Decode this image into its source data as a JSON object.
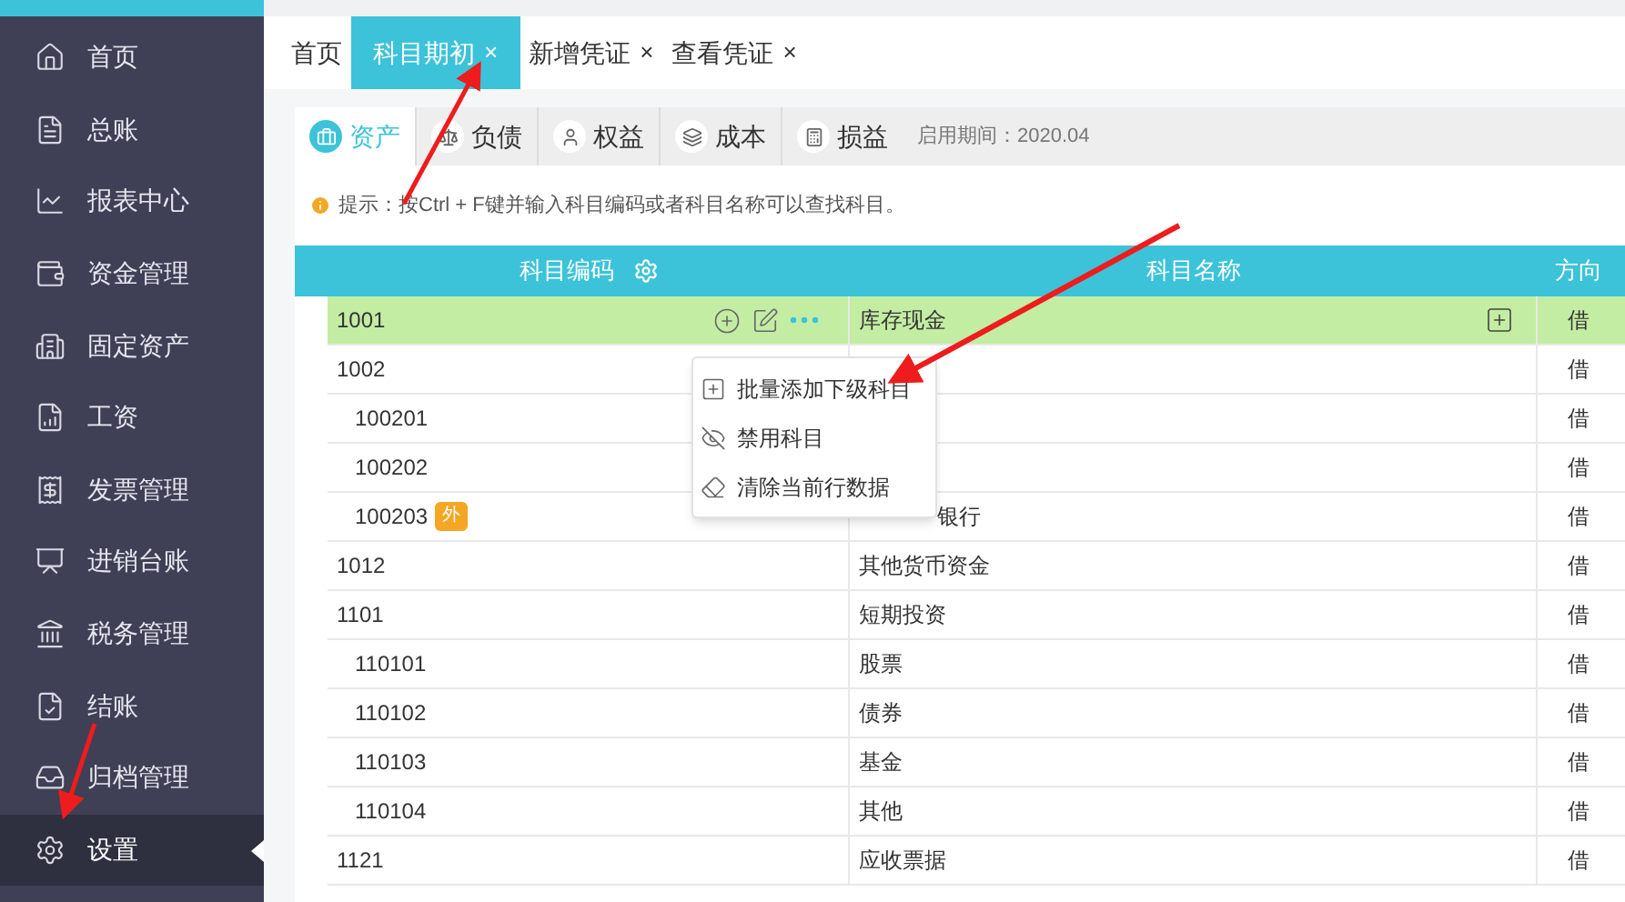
{
  "sidebar": {
    "items": [
      {
        "label": "首页",
        "selected": false
      },
      {
        "label": "总账",
        "selected": false
      },
      {
        "label": "报表中心",
        "selected": false
      },
      {
        "label": "资金管理",
        "selected": false
      },
      {
        "label": "固定资产",
        "selected": false
      },
      {
        "label": "工资",
        "selected": false
      },
      {
        "label": "发票管理",
        "selected": false
      },
      {
        "label": "进销台账",
        "selected": false
      },
      {
        "label": "税务管理",
        "selected": false
      },
      {
        "label": "结账",
        "selected": false
      },
      {
        "label": "归档管理",
        "selected": false
      },
      {
        "label": "设置",
        "selected": true
      }
    ]
  },
  "tabs": [
    {
      "label": "首页",
      "selected": false
    },
    {
      "label": "科目期初",
      "close": "×",
      "selected": true
    },
    {
      "label": "新增凭证",
      "close": "×",
      "selected": false
    },
    {
      "label": "查看凭证",
      "close": "×",
      "selected": false
    }
  ],
  "category_tabs": [
    {
      "label": "资产",
      "selected": true
    },
    {
      "label": "负债",
      "selected": false
    },
    {
      "label": "权益",
      "selected": false
    },
    {
      "label": "成本",
      "selected": false
    },
    {
      "label": "损益",
      "selected": false
    }
  ],
  "period": "启用期间：2020.04",
  "hint": "提示：按Ctrl + F键并输入科目编码或者科目名称可以查找科目。",
  "table": {
    "columns": [
      "科目编码",
      "科目名称",
      "方向"
    ],
    "rows": [
      {
        "code": "1001",
        "name": "库存现金",
        "direction": "借",
        "selected": true
      },
      {
        "code": "1002",
        "direction": "借",
        "selected": false,
        "children": [
          {
            "code": "100201",
            "direction": "借",
            "selected": false
          },
          {
            "code": "100202",
            "direction": "借",
            "selected": false
          },
          {
            "code": "100203",
            "badge": "外",
            "name": "银行",
            "name_cut": true,
            "direction": "借",
            "selected": false
          }
        ]
      },
      {
        "code": "1012",
        "name": "其他货币资金",
        "direction": "借",
        "selected": false
      },
      {
        "code": "1101",
        "name": "短期投资",
        "direction": "借",
        "selected": false,
        "children": [
          {
            "code": "110101",
            "name": "股票",
            "direction": "借",
            "selected": false
          },
          {
            "code": "110102",
            "name": "债券",
            "direction": "借",
            "selected": false
          },
          {
            "code": "110103",
            "name": "基金",
            "direction": "借",
            "selected": false
          },
          {
            "code": "110104",
            "name": "其他",
            "direction": "借",
            "selected": false
          }
        ]
      },
      {
        "code": "1121",
        "name": "应收票据",
        "direction": "借",
        "selected": false
      }
    ]
  },
  "row_menu": {
    "items": [
      "批量添加下级科目",
      "禁用科目",
      "清除当前行数据"
    ]
  }
}
